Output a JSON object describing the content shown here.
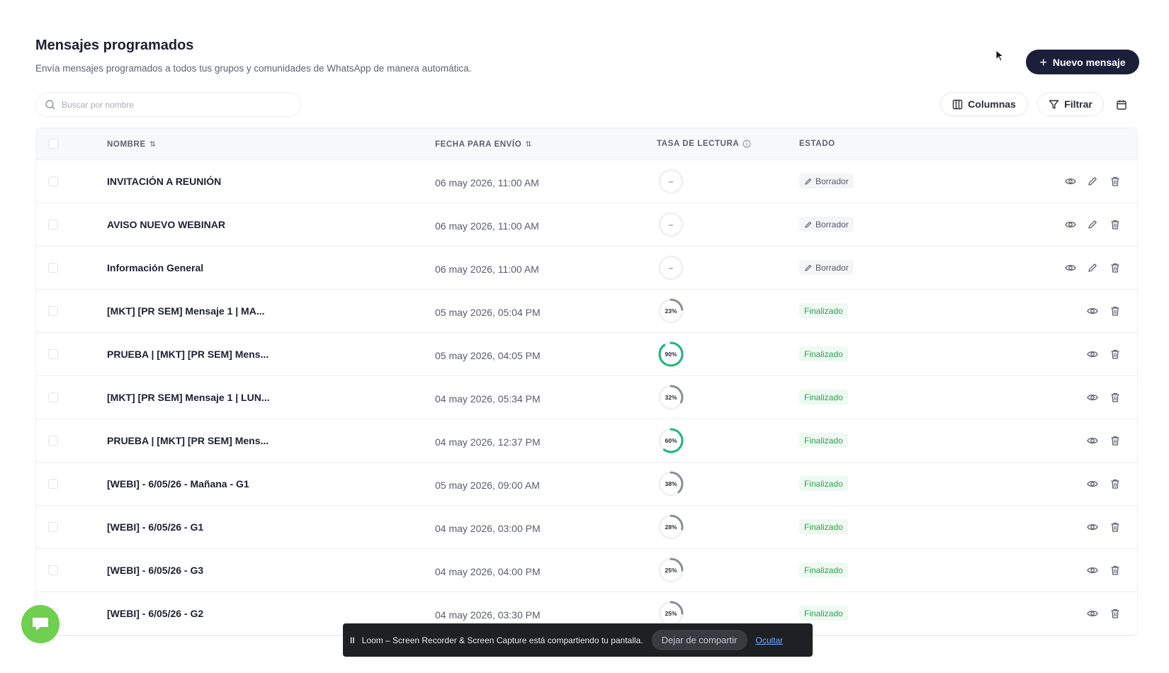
{
  "header": {
    "title": "Mensajes programados",
    "subtitle": "Envía mensajes programados a todos tus grupos y comunidades de WhatsApp de manera automática.",
    "new_button_label": "Nuevo mensaje"
  },
  "toolbar": {
    "search_placeholder": "Buscar por nombre",
    "columns_label": "Columnas",
    "filter_label": "Filtrar"
  },
  "table": {
    "headers": {
      "name": "NOMBRE",
      "date": "FECHA PARA ENVÍO",
      "rate": "TASA DE LECTURA",
      "status": "ESTADO"
    },
    "rows": [
      {
        "name": "INVITACIÓN A REUNIÓN",
        "date": "06 may 2026, 11:00 AM",
        "rate": "–",
        "rate_value": null,
        "status": "Borrador",
        "status_type": "draft"
      },
      {
        "name": "AVISO NUEVO WEBINAR",
        "date": "06 may 2026, 11:00 AM",
        "rate": "–",
        "rate_value": null,
        "status": "Borrador",
        "status_type": "draft"
      },
      {
        "name": "Información General",
        "date": "06 may 2026, 11:00 AM",
        "rate": "–",
        "rate_value": null,
        "status": "Borrador",
        "status_type": "draft"
      },
      {
        "name": "[MKT] [PR SEM] Mensaje 1 | MA...",
        "date": "05 may 2026, 05:04 PM",
        "rate": "23%",
        "rate_value": 23,
        "status": "Finalizado",
        "status_type": "done"
      },
      {
        "name": "PRUEBA | [MKT] [PR SEM] Mens...",
        "date": "05 may 2026, 04:05 PM",
        "rate": "90%",
        "rate_value": 90,
        "status": "Finalizado",
        "status_type": "done"
      },
      {
        "name": "[MKT] [PR SEM] Mensaje 1 | LUN...",
        "date": "04 may 2026, 05:34 PM",
        "rate": "32%",
        "rate_value": 32,
        "status": "Finalizado",
        "status_type": "done"
      },
      {
        "name": "PRUEBA | [MKT] [PR SEM] Mens...",
        "date": "04 may 2026, 12:37 PM",
        "rate": "60%",
        "rate_value": 60,
        "status": "Finalizado",
        "status_type": "done"
      },
      {
        "name": "[WEBI] - 6/05/26 - Mañana - G1",
        "date": "05 may 2026, 09:00 AM",
        "rate": "38%",
        "rate_value": 38,
        "status": "Finalizado",
        "status_type": "done"
      },
      {
        "name": "[WEBI] - 6/05/26 - G1",
        "date": "04 may 2026, 03:00 PM",
        "rate": "28%",
        "rate_value": 28,
        "status": "Finalizado",
        "status_type": "done"
      },
      {
        "name": "[WEBI] - 6/05/26 - G3",
        "date": "04 may 2026, 04:00 PM",
        "rate": "25%",
        "rate_value": 25,
        "status": "Finalizado",
        "status_type": "done"
      },
      {
        "name": "[WEBI] - 6/05/26 - G2",
        "date": "04 may 2026, 03:30 PM",
        "rate": "25%",
        "rate_value": 25,
        "status": "Finalizado",
        "status_type": "done"
      }
    ]
  },
  "loom": {
    "message": "Loom – Screen Recorder & Screen Capture está compartiendo tu pantalla.",
    "stop_label": "Dejar de compartir",
    "hide_label": "Ocultar"
  },
  "colors": {
    "primary_button": "#1b1f3a",
    "success_green": "#2f9e54",
    "ring_high": "#19b87a",
    "ring_low": "#8a8d96"
  }
}
